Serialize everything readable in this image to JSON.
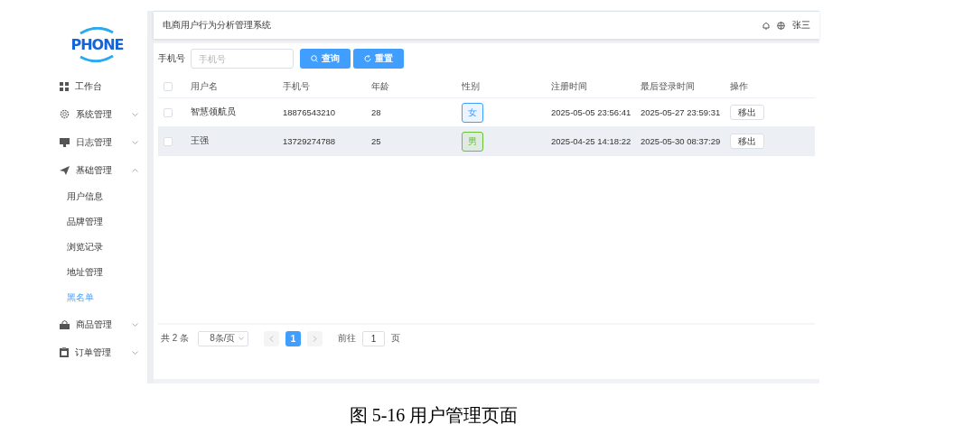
{
  "logo": {
    "text": "PHONE"
  },
  "sidebar": {
    "items": [
      {
        "label": "工作台",
        "kind": "link"
      },
      {
        "label": "系统管理",
        "kind": "submenu",
        "expanded": false
      },
      {
        "label": "日志管理",
        "kind": "submenu",
        "expanded": false
      },
      {
        "label": "基础管理",
        "kind": "submenu",
        "expanded": true,
        "children": [
          {
            "label": "用户信息",
            "selected": false
          },
          {
            "label": "品牌管理",
            "selected": false
          },
          {
            "label": "浏览记录",
            "selected": false
          },
          {
            "label": "地址管理",
            "selected": false
          },
          {
            "label": "黑名单",
            "selected": true
          }
        ]
      },
      {
        "label": "商品管理",
        "kind": "submenu",
        "expanded": false
      },
      {
        "label": "订单管理",
        "kind": "submenu",
        "expanded": false
      }
    ]
  },
  "header": {
    "title": "电商用户行为分析管理系统",
    "user": "张三"
  },
  "search": {
    "label": "手机号",
    "placeholder": "手机号",
    "buttons": [
      "查询",
      "重置"
    ]
  },
  "table": {
    "select_all_checked": false,
    "columns": [
      "用户名",
      "手机号",
      "年龄",
      "性别",
      "注册时间",
      "最后登录时间",
      "操作"
    ],
    "rows": [
      {
        "checked": false,
        "highlighted": false,
        "name": "智慧领航员",
        "phone": "18876543210",
        "age": "28",
        "gender": {
          "label": "女",
          "color": "#409eff"
        },
        "registered": "2025-05-05 23:56:41",
        "last_login": "2025-05-27 23:59:31",
        "action": "移出"
      },
      {
        "checked": false,
        "highlighted": true,
        "name": "王强",
        "phone": "13729274788",
        "age": "25",
        "gender": {
          "label": "男",
          "color": "#67c23a"
        },
        "registered": "2025-04-25 14:18:22",
        "last_login": "2025-05-30 08:37:29",
        "action": "移出"
      }
    ]
  },
  "pagination": {
    "total": "共 2 条",
    "page_size": "8条/页",
    "pages": [
      {
        "label": "1",
        "selected": true
      }
    ],
    "goto_label": "前往",
    "goto_value": "1",
    "goto_unit": "页"
  },
  "caption": "图 5-16 用户管理页面"
}
